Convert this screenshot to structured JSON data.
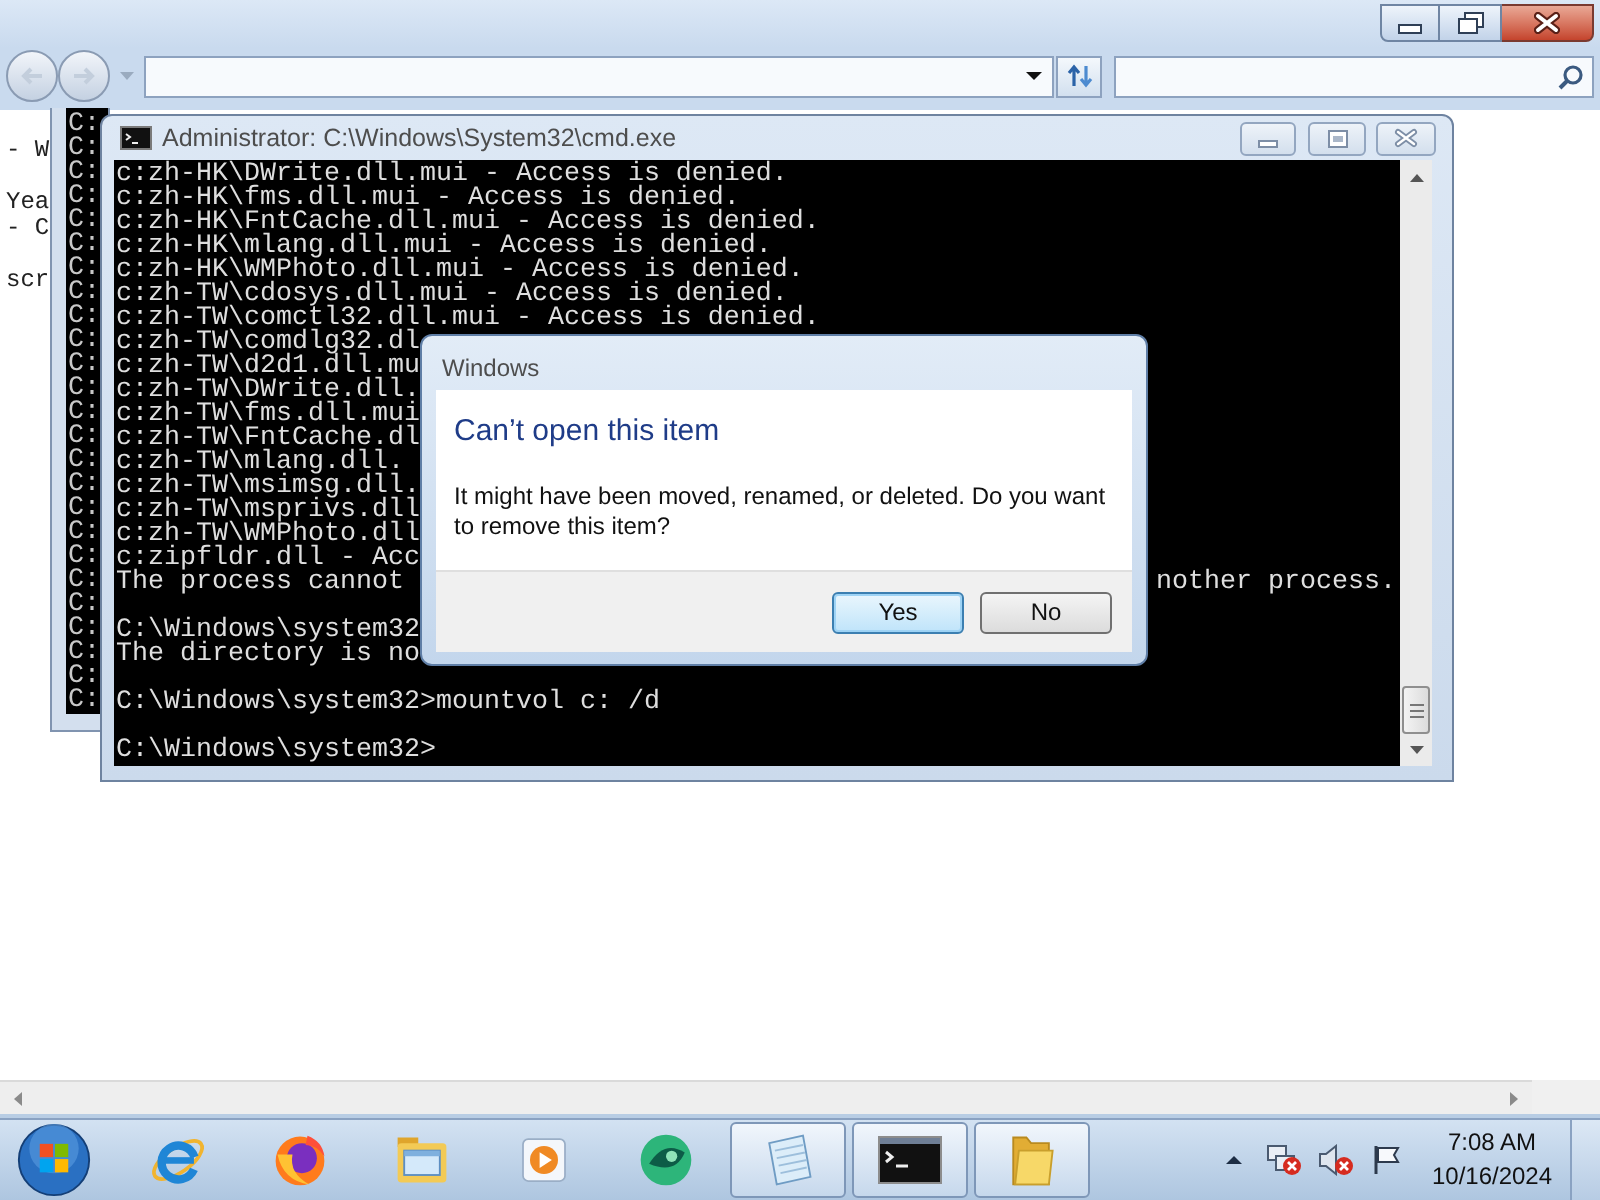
{
  "browser": {
    "page_text": [
      [
        "- W"
      ],
      [
        "Yea",
        "- C"
      ],
      [
        "scr"
      ]
    ]
  },
  "background_console": {
    "lines": [
      "C:",
      "C:",
      "C:",
      "C:",
      "C:",
      "C:",
      "C:",
      "C:",
      "C:",
      "C:",
      "C:",
      "C:",
      "C:",
      "C:",
      "C:",
      "C:",
      "C:",
      "C:",
      "C:",
      "C:",
      "C:",
      "C:",
      "C:",
      "C:",
      "C:"
    ]
  },
  "console": {
    "title": "Administrator: C:\\Windows\\System32\\cmd.exe",
    "lines": [
      {
        "kind": "text",
        "text": "c:zh-HK\\DWrite.dll.mui - Access is denied."
      },
      {
        "kind": "text",
        "text": "c:zh-HK\\fms.dll.mui - Access is denied."
      },
      {
        "kind": "text",
        "text": "c:zh-HK\\FntCache.dll.mui - Access is denied."
      },
      {
        "kind": "text",
        "text": "c:zh-HK\\mlang.dll.mui - Access is denied."
      },
      {
        "kind": "text",
        "text": "c:zh-HK\\WMPhoto.dll.mui - Access is denied."
      },
      {
        "kind": "text",
        "text": "c:zh-TW\\cdosys.dll.mui - Access is denied."
      },
      {
        "kind": "text",
        "text": "c:zh-TW\\comctl32.dll.mui - Access is denied."
      },
      {
        "kind": "text",
        "text": "c:zh-TW\\comdlg32.dl"
      },
      {
        "kind": "text",
        "text": "c:zh-TW\\d2d1.dll.mu"
      },
      {
        "kind": "text",
        "text": "c:zh-TW\\DWrite.dll."
      },
      {
        "kind": "text",
        "text": "c:zh-TW\\fms.dll.mui"
      },
      {
        "kind": "text",
        "text": "c:zh-TW\\FntCache.dl"
      },
      {
        "kind": "text",
        "text": "c:zh-TW\\mlang.dll."
      },
      {
        "kind": "text",
        "text": "c:zh-TW\\msimsg.dll."
      },
      {
        "kind": "text",
        "text": "c:zh-TW\\msprivs.dll"
      },
      {
        "kind": "text",
        "text": "c:zh-TW\\WMPhoto.dll"
      },
      {
        "kind": "text",
        "text": "c:zipfldr.dll - Acc"
      },
      {
        "kind": "text",
        "text": "The process cannot",
        "tail": "nother process."
      },
      {
        "kind": "blank"
      },
      {
        "kind": "text",
        "text": "C:\\Windows\\system32"
      },
      {
        "kind": "text",
        "text": "The directory is no"
      },
      {
        "kind": "blank"
      },
      {
        "kind": "text",
        "text": "C:\\Windows\\system32>mountvol c: /d"
      },
      {
        "kind": "blank"
      },
      {
        "kind": "text",
        "text": "C:\\Windows\\system32>"
      }
    ]
  },
  "dialog": {
    "title": "Windows",
    "heading": "Can’t open this item",
    "message": "It might have been moved, renamed, or deleted. Do you want to remove this item?",
    "buttons": [
      {
        "label": "Yes",
        "default": true
      },
      {
        "label": "No",
        "default": false
      }
    ]
  },
  "taskbar": {
    "apps": [
      {
        "kind": "e-logo",
        "running": false
      },
      {
        "kind": "flame-globe",
        "running": false
      },
      {
        "kind": "file-manager",
        "running": false
      },
      {
        "kind": "media-player",
        "running": false
      },
      {
        "kind": "round-logo",
        "running": false
      },
      {
        "kind": "notepad",
        "running": true
      },
      {
        "kind": "terminal",
        "running": true
      },
      {
        "kind": "folder",
        "running": true
      }
    ],
    "clock": {
      "time": "7:08 AM",
      "date": "10/16/2024"
    }
  }
}
